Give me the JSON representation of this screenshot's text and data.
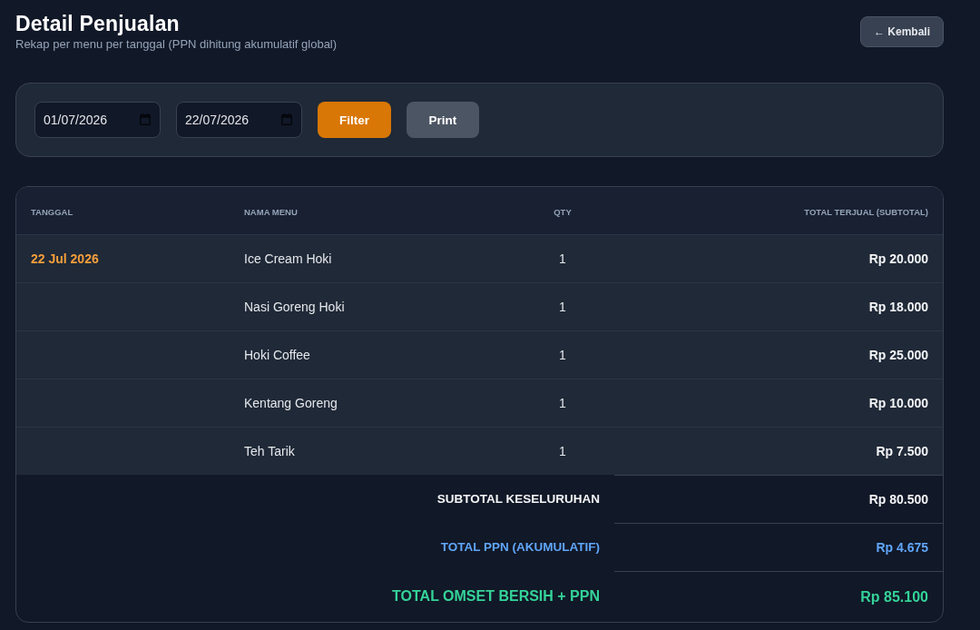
{
  "header": {
    "title": "Detail Penjualan",
    "subtitle": "Rekap per menu per tanggal (PPN dihitung akumulatif global)",
    "back_button": "← Kembali"
  },
  "filter": {
    "date_fields": [
      {
        "value": "01/07/2026"
      },
      {
        "value": "22/07/2026"
      }
    ],
    "buttons": [
      {
        "kind": "filter",
        "label": "Filter"
      },
      {
        "kind": "print",
        "label": "Print"
      }
    ]
  },
  "table": {
    "columns": [
      "TANGGAL",
      "NAMA MENU",
      "QTY",
      "TOTAL TERJUAL (SUBTOTAL)"
    ],
    "rows": [
      {
        "date": "22 Jul 2026",
        "menu": "Ice Cream Hoki",
        "qty": "1",
        "subtotal": "Rp 20.000"
      },
      {
        "menu": "Nasi Goreng Hoki",
        "qty": "1",
        "subtotal": "Rp 18.000"
      },
      {
        "menu": "Hoki Coffee",
        "qty": "1",
        "subtotal": "Rp 25.000"
      },
      {
        "menu": "Kentang Goreng",
        "qty": "1",
        "subtotal": "Rp 10.000"
      },
      {
        "menu": "Teh Tarik",
        "qty": "1",
        "subtotal": "Rp 7.500"
      }
    ],
    "totals": [
      {
        "kind": "subtotal",
        "label": "SUBTOTAL KESELURUHAN",
        "value": "Rp 80.500"
      },
      {
        "kind": "tax",
        "label": "TOTAL PPN (AKUMULATIF)",
        "value": "Rp 4.675"
      },
      {
        "kind": "grand",
        "label": "TOTAL OMSET BERSIH + PPN",
        "value": "Rp 85.100"
      }
    ]
  }
}
